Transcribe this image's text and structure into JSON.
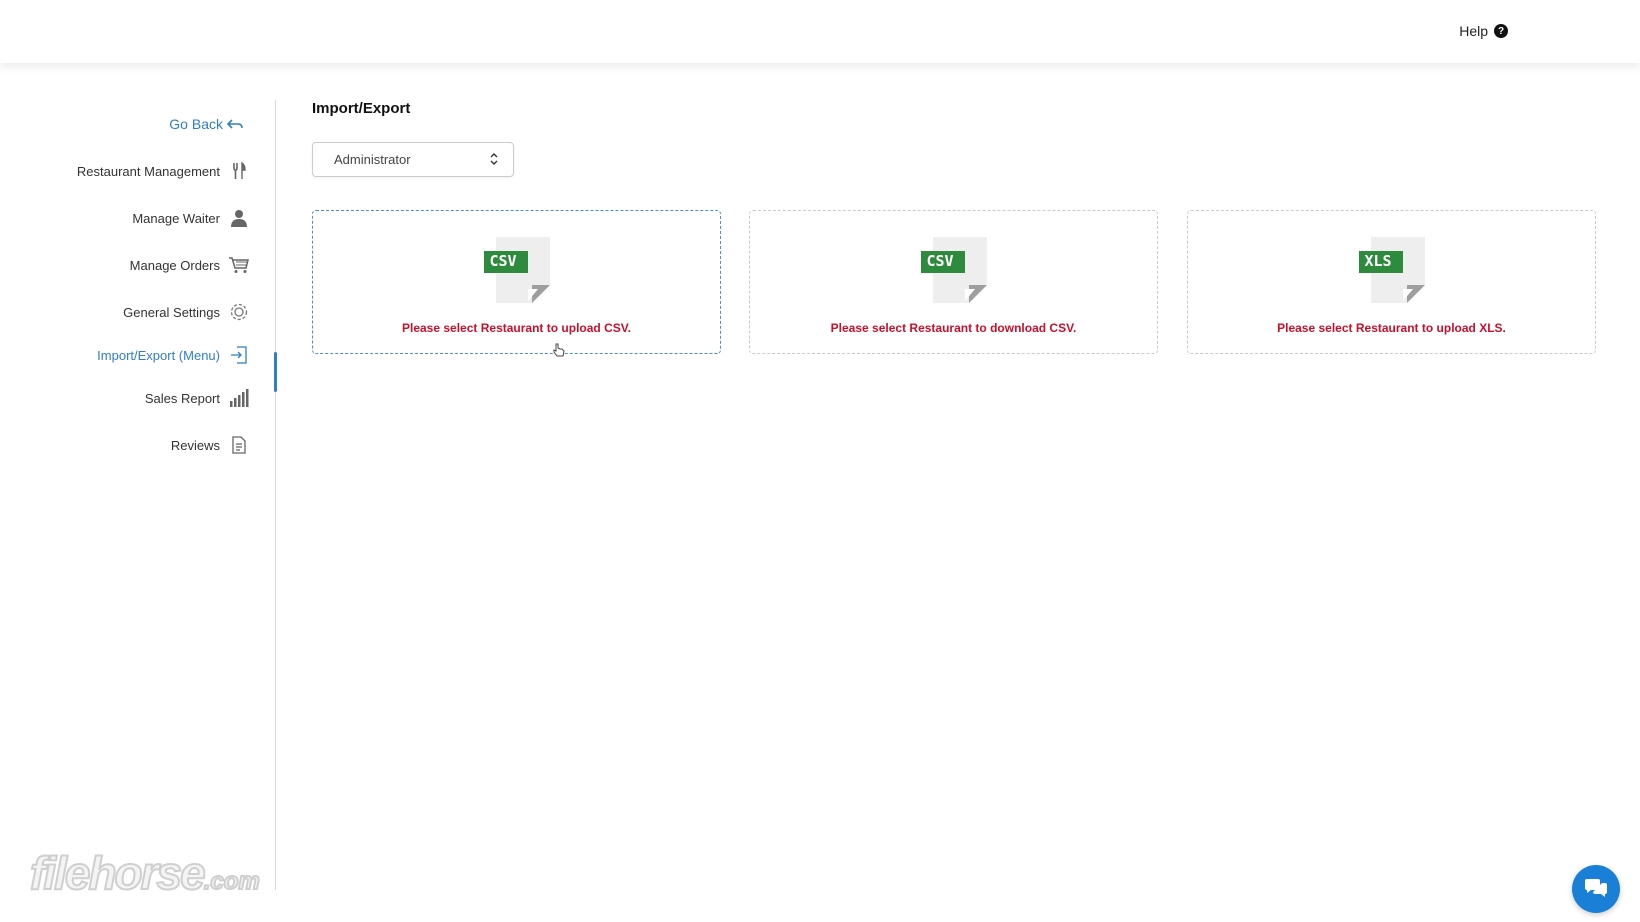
{
  "header": {
    "help_label": "Help",
    "help_icon": "question-circle-icon"
  },
  "sidebar": {
    "go_back_label": "Go Back",
    "items": [
      {
        "label": "Restaurant Management",
        "icon": "fork-knife-icon",
        "active": false
      },
      {
        "label": "Manage Waiter",
        "icon": "user-icon",
        "active": false
      },
      {
        "label": "Manage Orders",
        "icon": "cart-icon",
        "active": false
      },
      {
        "label": "General Settings",
        "icon": "gear-icon",
        "active": false
      },
      {
        "label": "Import/Export (Menu)",
        "icon": "import-icon",
        "active": true
      },
      {
        "label": "Sales Report",
        "icon": "bar-chart-icon",
        "active": false
      },
      {
        "label": "Reviews",
        "icon": "document-icon",
        "active": false
      }
    ]
  },
  "main": {
    "title": "Import/Export",
    "select": {
      "value": "Administrator"
    },
    "cards": [
      {
        "file_type": "CSV",
        "message": "Please select Restaurant to upload CSV."
      },
      {
        "file_type": "CSV",
        "message": "Please select Restaurant to download CSV."
      },
      {
        "file_type": "XLS",
        "message": "Please select Restaurant to upload XLS."
      }
    ]
  },
  "watermark": {
    "text": "filehorse",
    "suffix": ".com"
  },
  "colors": {
    "accent": "#2f7fc1",
    "error": "#c8102e",
    "file_badge": "#2e8b3e",
    "chat_button": "#1a7fd6"
  }
}
